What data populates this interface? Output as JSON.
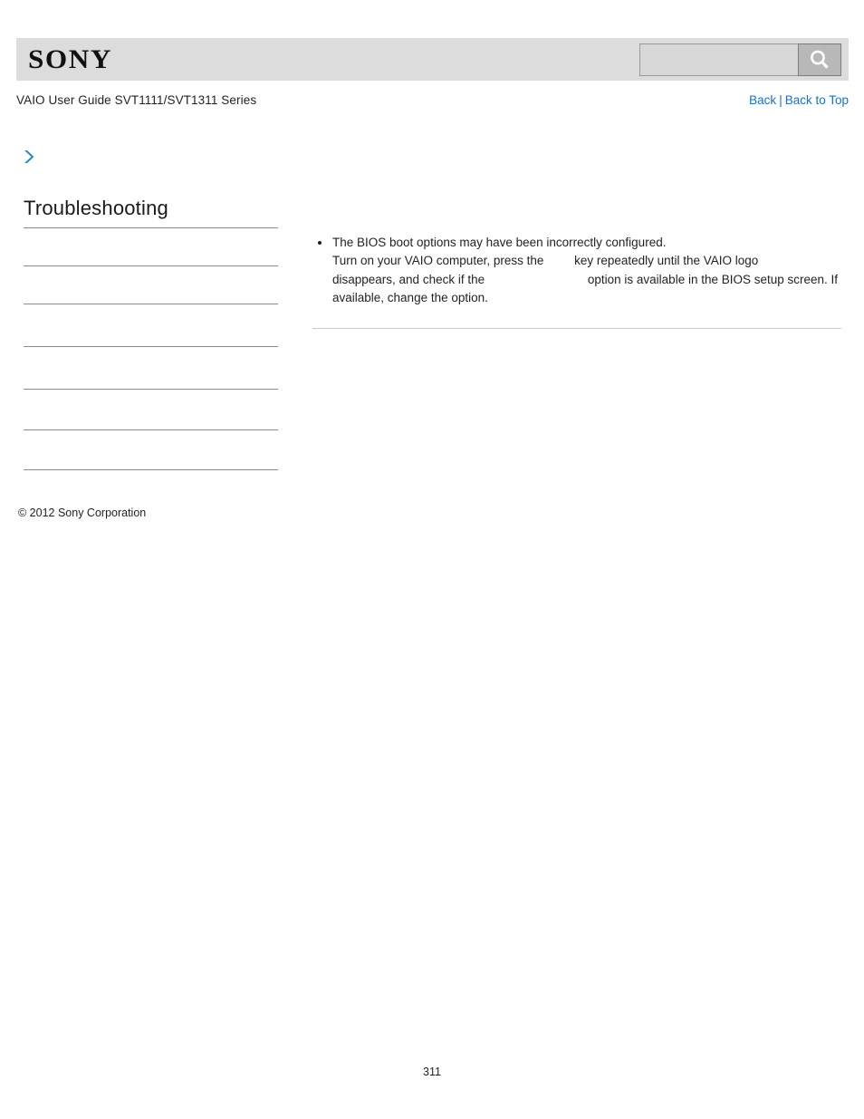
{
  "header": {
    "logo_text": "SONY",
    "search": {
      "value": "",
      "placeholder": "",
      "icon": "search-icon",
      "button_label": ""
    }
  },
  "title_bar": {
    "guide_title": "VAIO User Guide SVT1111/SVT1311 Series",
    "nav": {
      "back_label": "Back",
      "separator": "|",
      "back_to_top_label": "Back to Top"
    }
  },
  "breadcrumb": {
    "arrow_icon": "chevron-right-icon"
  },
  "sidebar": {
    "heading": "Troubleshooting",
    "items": [
      {
        "label": ""
      },
      {
        "label": ""
      },
      {
        "label": ""
      },
      {
        "label": ""
      },
      {
        "label": ""
      },
      {
        "label": ""
      }
    ]
  },
  "content": {
    "bullets": [
      {
        "line1": "The BIOS boot options may have been incorrectly configured.",
        "line2_pre": "Turn on your VAIO computer, press the",
        "line2_key": "",
        "line2_post": "key repeatedly until the VAIO logo",
        "line3_pre": "disappears, and check if the",
        "line3_key": "",
        "line3_post": "option is available in the BIOS setup screen. If",
        "line4": "available, change the option."
      }
    ]
  },
  "footer": {
    "copyright": "© 2012 Sony Corporation",
    "page_number": "311"
  },
  "colors": {
    "header_band": "#dcdcdc",
    "link_blue": "#1a6fc4",
    "arrow_blue": "#2a8ac8",
    "rule_gray": "#8b8b8b",
    "content_rule_gray": "#c9c9c9",
    "text": "#231f20"
  }
}
